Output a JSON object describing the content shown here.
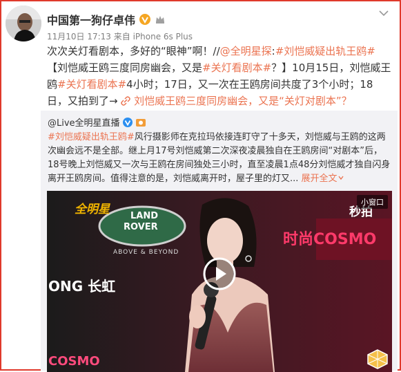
{
  "post": {
    "username": "中国第一狗仔卓伟",
    "meta": "11月10日 17:13 来自 iPhone 6s Plus",
    "text": {
      "t1": "次次关灯看剧本，多好的“眼神”啊！//",
      "l1": "@全明星探",
      "t2": ":",
      "l2": "#刘恺威疑出轨王鸥#",
      "t3": "【刘恺威王鸥三度同房幽会，又是",
      "l3": "#关灯看剧本#",
      "t4": "？】10月15日，刘恺威王鸥",
      "l4": "#关灯看剧本#",
      "t5": "4小时；17日，又一次在王鸥房间共度了3个小时；18日，又拍到了→",
      "l5": "刘恺威王鸥三度同房幽会，又是“关灯对剧本”？"
    }
  },
  "quoted": {
    "username": "@Live全明星直播",
    "text": {
      "l1": "#刘恺威疑出轨王鸥#",
      "t1": "风行摄影师在克拉玛依接连盯守了十多天，刘恺威与王鸥的这两次幽会远不是全部。继上月17号刘恺威第二次深夜凌晨独自在王鸥房间“对剧本”后，18号晚上刘恺威又一次与王鸥在房间独处三小时，直至凌晨1点48分刘恺威才独自闪身离开王鸥房间。值得注意的是，刘恺威离开时，屋子里的灯又...",
      "expand": "展开全文"
    }
  },
  "video": {
    "mini_window": "小窗口",
    "watermarks": {
      "quanmingxing": "全明星",
      "land_rover_1": "LAND",
      "land_rover_2": "ROVER",
      "above_beyond": "ABOVE & BEYOND",
      "miaopai": "秒拍",
      "cosmo_top": "时尚COSMO",
      "changhong": "ONG 长虹",
      "cosmo_bottom": "COSMO"
    }
  },
  "colors": {
    "link": "#eb7350",
    "frame": "#e0392b"
  }
}
